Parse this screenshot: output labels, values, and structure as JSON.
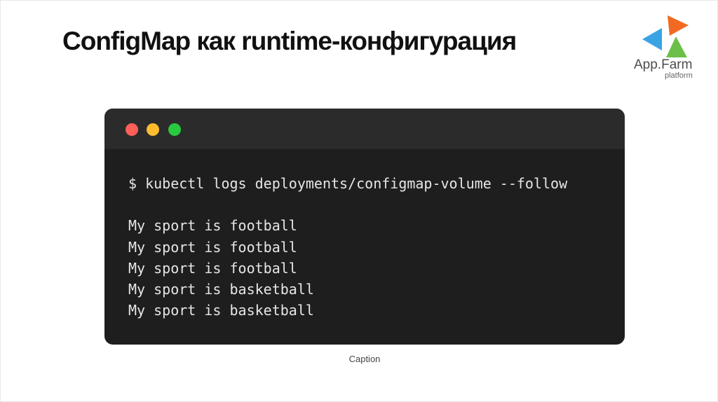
{
  "slide": {
    "title": "ConfigMap как runtime-конфигурация",
    "caption": "Caption"
  },
  "logo": {
    "name": "App.Farm",
    "sub": "platform",
    "colors": {
      "orange": "#f26a21",
      "blue": "#3aa3e3",
      "green": "#6cc04a"
    }
  },
  "terminal": {
    "window_buttons": [
      "close",
      "minimize",
      "maximize"
    ],
    "colors": {
      "background": "#1e1e1e",
      "titlebar": "#2b2b2b",
      "close": "#ff5f57",
      "minimize": "#febc2e",
      "maximize": "#28c840"
    },
    "command": "$ kubectl logs deployments/configmap-volume --follow",
    "output": [
      "My sport is football",
      "My sport is football",
      "My sport is football",
      "My sport is basketball",
      "My sport is basketball"
    ]
  }
}
